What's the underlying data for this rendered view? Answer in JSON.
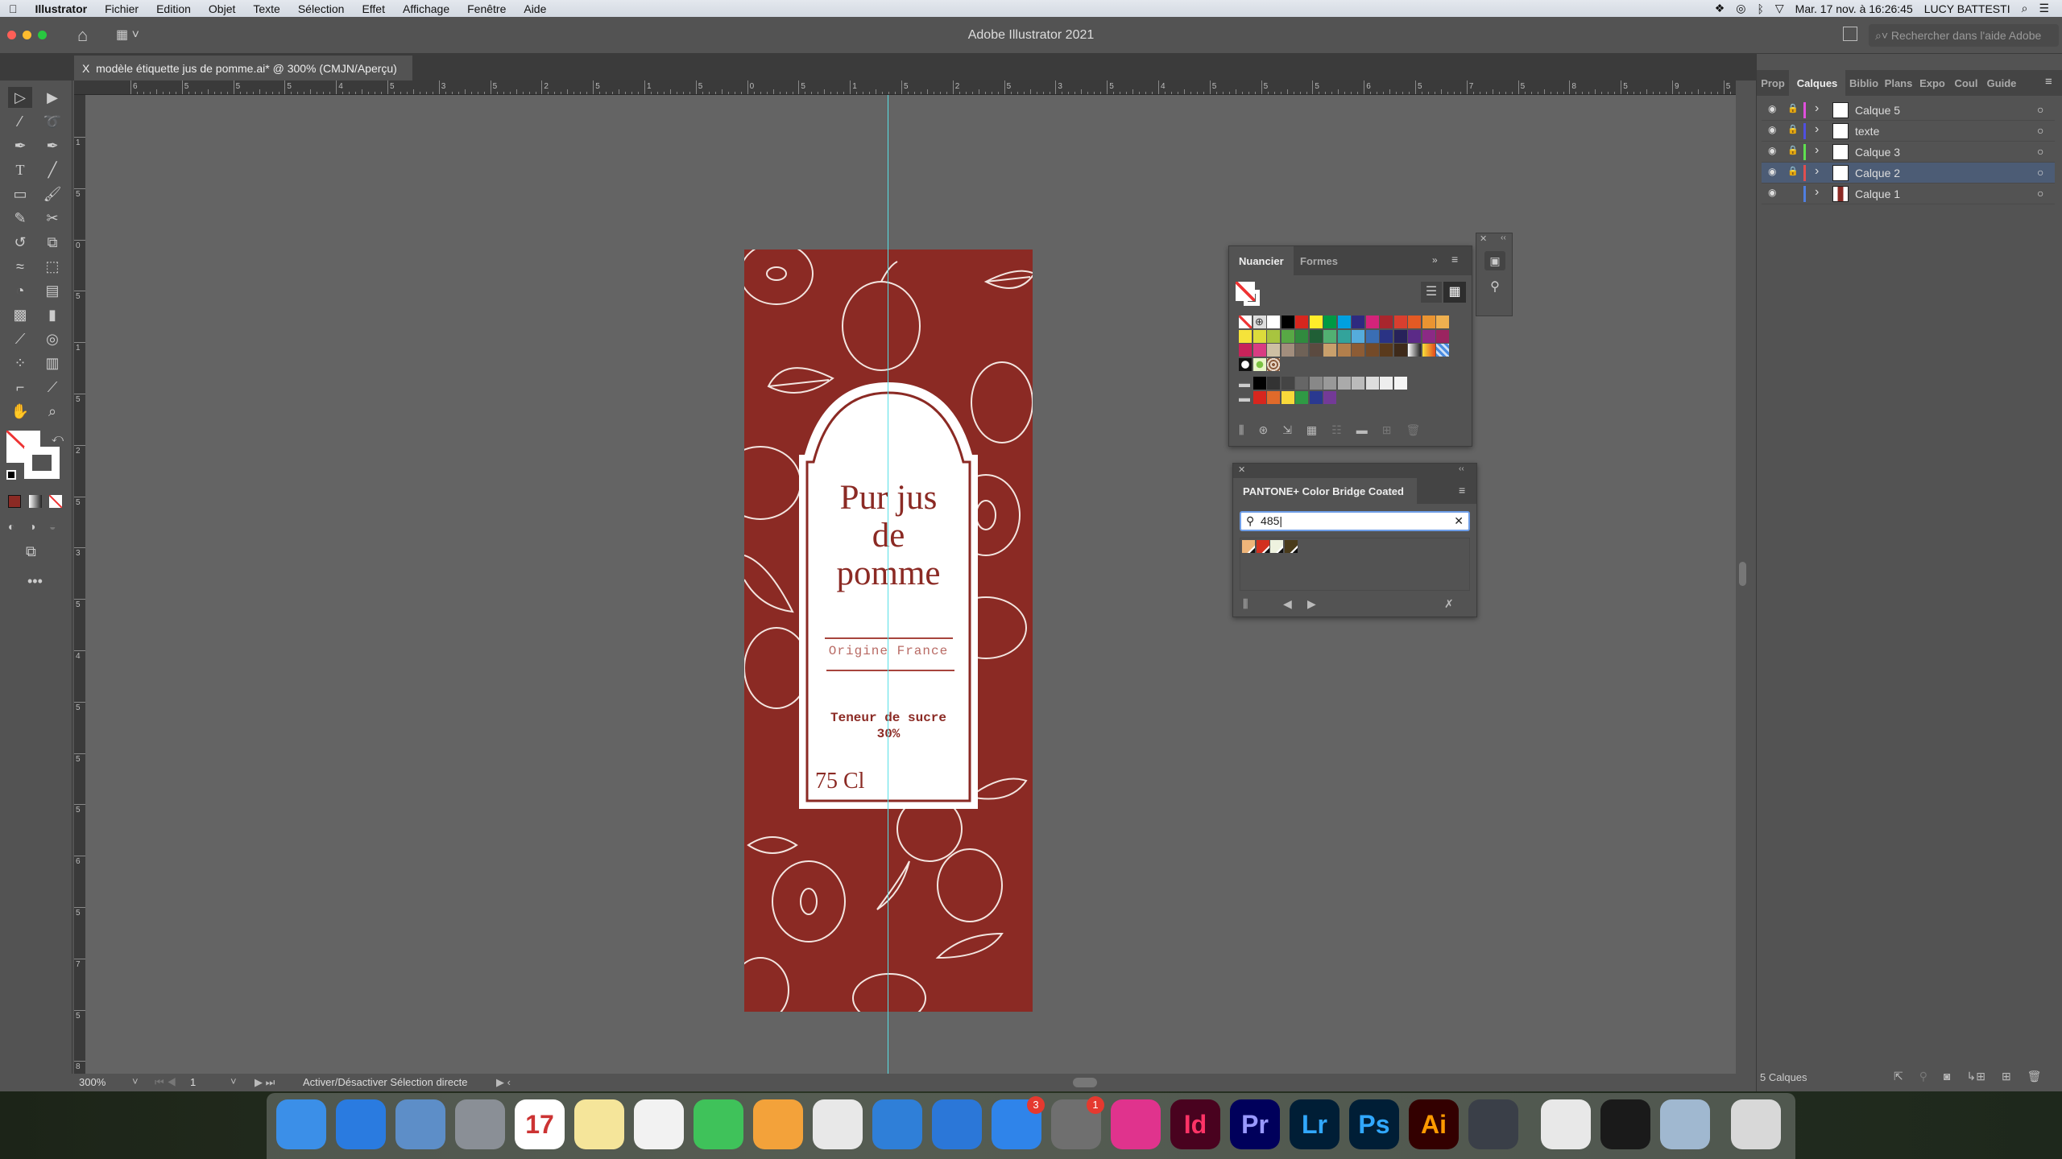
{
  "menubar": {
    "apple_icon": "apple-logo",
    "app": "Illustrator",
    "items": [
      "Fichier",
      "Edition",
      "Objet",
      "Texte",
      "Sélection",
      "Effet",
      "Affichage",
      "Fenêtre",
      "Aide"
    ],
    "clock": "Mar. 17 nov. à  16:26:45",
    "user": "LUCY BATTESTI"
  },
  "titlebar": {
    "title": "Adobe Illustrator 2021",
    "help_placeholder": "Rechercher dans l'aide Adobe"
  },
  "document_tab": {
    "close": "X",
    "label": "modèle étiquette jus de pomme.ai* @ 300% (CMJN/Aperçu)"
  },
  "rulers": {
    "horizontal": [
      "6",
      "5",
      "5",
      "5",
      "4",
      "5",
      "3",
      "5",
      "2",
      "5",
      "1",
      "5",
      "0",
      "5",
      "1",
      "5",
      "2",
      "5",
      "3",
      "5",
      "4",
      "5",
      "5",
      "5",
      "6",
      "5",
      "7",
      "5",
      "8",
      "5",
      "9",
      "5"
    ],
    "vertical": [
      "1",
      "5",
      "0",
      "5",
      "1",
      "5",
      "2",
      "5",
      "3",
      "5",
      "4",
      "5",
      "5",
      "5",
      "6",
      "5",
      "7",
      "5",
      "8"
    ]
  },
  "label": {
    "title_line1": "Pur jus",
    "title_line2": "de",
    "title_line3": "pomme",
    "origin": "Origine France",
    "sugar_line1": "Teneur de sucre",
    "sugar_line2": "30%",
    "volume": "75 Cl",
    "background_color": "#8b2a24",
    "text_color": "#8b2a24"
  },
  "status": {
    "zoom": "300%",
    "artboard": "1",
    "message": "Activer/Désactiver Sélection directe"
  },
  "right_panel": {
    "tabs": [
      "Prop",
      "Calques",
      "Biblio",
      "Plans",
      "Expo",
      "Coul",
      "Guide"
    ],
    "active_tab": "Calques",
    "layers": [
      {
        "name": "Calque 5",
        "color": "#e04fdc",
        "locked": true,
        "selected": false
      },
      {
        "name": "texte",
        "color": "#4f4fe0",
        "locked": true,
        "selected": false
      },
      {
        "name": "Calque 3",
        "color": "#5fe04f",
        "locked": true,
        "selected": false
      },
      {
        "name": "Calque 2",
        "color": "#e04f4f",
        "locked": true,
        "selected": true
      },
      {
        "name": "Calque 1",
        "color": "#4f7fe0",
        "locked": false,
        "selected": false
      }
    ],
    "footer": "5 Calques"
  },
  "swatches_panel": {
    "tabs": [
      "Nuancier",
      "Formes"
    ],
    "active_tab": "Nuancier",
    "rows": [
      [
        "none",
        "registration",
        "#ffffff",
        "#000000",
        "#d7261e",
        "#ffed2a",
        "#009944",
        "#00a0e0",
        "#2e2a7f",
        "#d4237a",
        "#a8262d",
        "#d93f2f",
        "#e35a24",
        "#ea9431",
        "#efb04f"
      ],
      [
        "#f5e33a",
        "#dcdc3b",
        "#a8c43f",
        "#58a845",
        "#308a3e",
        "#205f36",
        "#52b072",
        "#33a39b",
        "#55acdc",
        "#3a6eb4",
        "#2a3384",
        "#27225a",
        "#5b2a87",
        "#8b2a85",
        "#9b2460"
      ],
      [
        "#c8235a",
        "#d93c82",
        "#cdbfa3",
        "#a28e7d",
        "#6f6257",
        "#5b4a40",
        "#c9a06c",
        "#b27f4c",
        "#8d5c35",
        "#744a28",
        "#5a3a1c",
        "#3e2a1a",
        "gradient-gray",
        "gradient-yellow",
        "pattern-blue"
      ],
      [
        "pattern-dots",
        "pattern-green",
        "pattern-brown"
      ],
      [
        "folder",
        "#000000",
        "#333333",
        "#444444",
        "#666666",
        "#888888",
        "#999999",
        "#aaaaaa",
        "#bbbbbb",
        "#dddddd",
        "#eeeeee",
        "#f5f5f5"
      ],
      [
        "folder",
        "#d7261e",
        "#e06a2a",
        "#f8d93a",
        "#2f9a44",
        "#2a3990",
        "#733a97"
      ]
    ]
  },
  "pantone_panel": {
    "title": "PANTONE+ Color Bridge Coated",
    "search_value": "485",
    "results": [
      "#eeb57a",
      "#d2301f",
      "#eef2df",
      "#4a3b1a"
    ]
  },
  "dock": {
    "apps": [
      {
        "name": "Finder",
        "bg": "#3b8fe8",
        "text": ""
      },
      {
        "name": "Safari",
        "bg": "#2a7be0",
        "text": ""
      },
      {
        "name": "Mail",
        "bg": "#5d8ec8",
        "text": ""
      },
      {
        "name": "Launchpad",
        "bg": "#8a8f96",
        "text": ""
      },
      {
        "name": "Calendrier",
        "bg": "#ffffff",
        "text": "17"
      },
      {
        "name": "Notes",
        "bg": "#f5e59a",
        "text": ""
      },
      {
        "name": "Photos",
        "bg": "#f2f2f2",
        "text": ""
      },
      {
        "name": "FaceTime",
        "bg": "#3fc25a",
        "text": ""
      },
      {
        "name": "Pages",
        "bg": "#f3a23a",
        "text": ""
      },
      {
        "name": "Fichier",
        "bg": "#e8e8e8",
        "text": ""
      },
      {
        "name": "Keynote",
        "bg": "#2f7fd8",
        "text": ""
      },
      {
        "name": "TeamViewer",
        "bg": "#2b77d8",
        "text": ""
      },
      {
        "name": "App Store",
        "bg": "#2f84ea",
        "text": "",
        "badge": "3"
      },
      {
        "name": "Préférences Système",
        "bg": "#6f6f6f",
        "text": "",
        "badge": "1"
      },
      {
        "name": "Creative Cloud",
        "bg": "#e0338d",
        "text": ""
      },
      {
        "name": "InDesign",
        "bg": "#49021f",
        "text": "Id",
        "fg": "#ff3366"
      },
      {
        "name": "Premiere Pro",
        "bg": "#00005b",
        "text": "Pr",
        "fg": "#9999ff"
      },
      {
        "name": "Lightroom",
        "bg": "#001e36",
        "text": "Lr",
        "fg": "#31a8ff"
      },
      {
        "name": "Photoshop",
        "bg": "#001e36",
        "text": "Ps",
        "fg": "#31a8ff"
      },
      {
        "name": "Illustrator",
        "bg": "#330000",
        "text": "Ai",
        "fg": "#ff9a00"
      },
      {
        "name": "QuickTime",
        "bg": "#3a3f48",
        "text": ""
      },
      {
        "name": "Chrome",
        "bg": "#e8e8e8",
        "text": ""
      },
      {
        "name": "Acrobat",
        "bg": "#1a1a1a",
        "text": ""
      },
      {
        "name": "Aperçu",
        "bg": "#a0b8d0",
        "text": ""
      },
      {
        "name": "Corbeille",
        "bg": "#d8d8d8",
        "text": ""
      }
    ]
  }
}
